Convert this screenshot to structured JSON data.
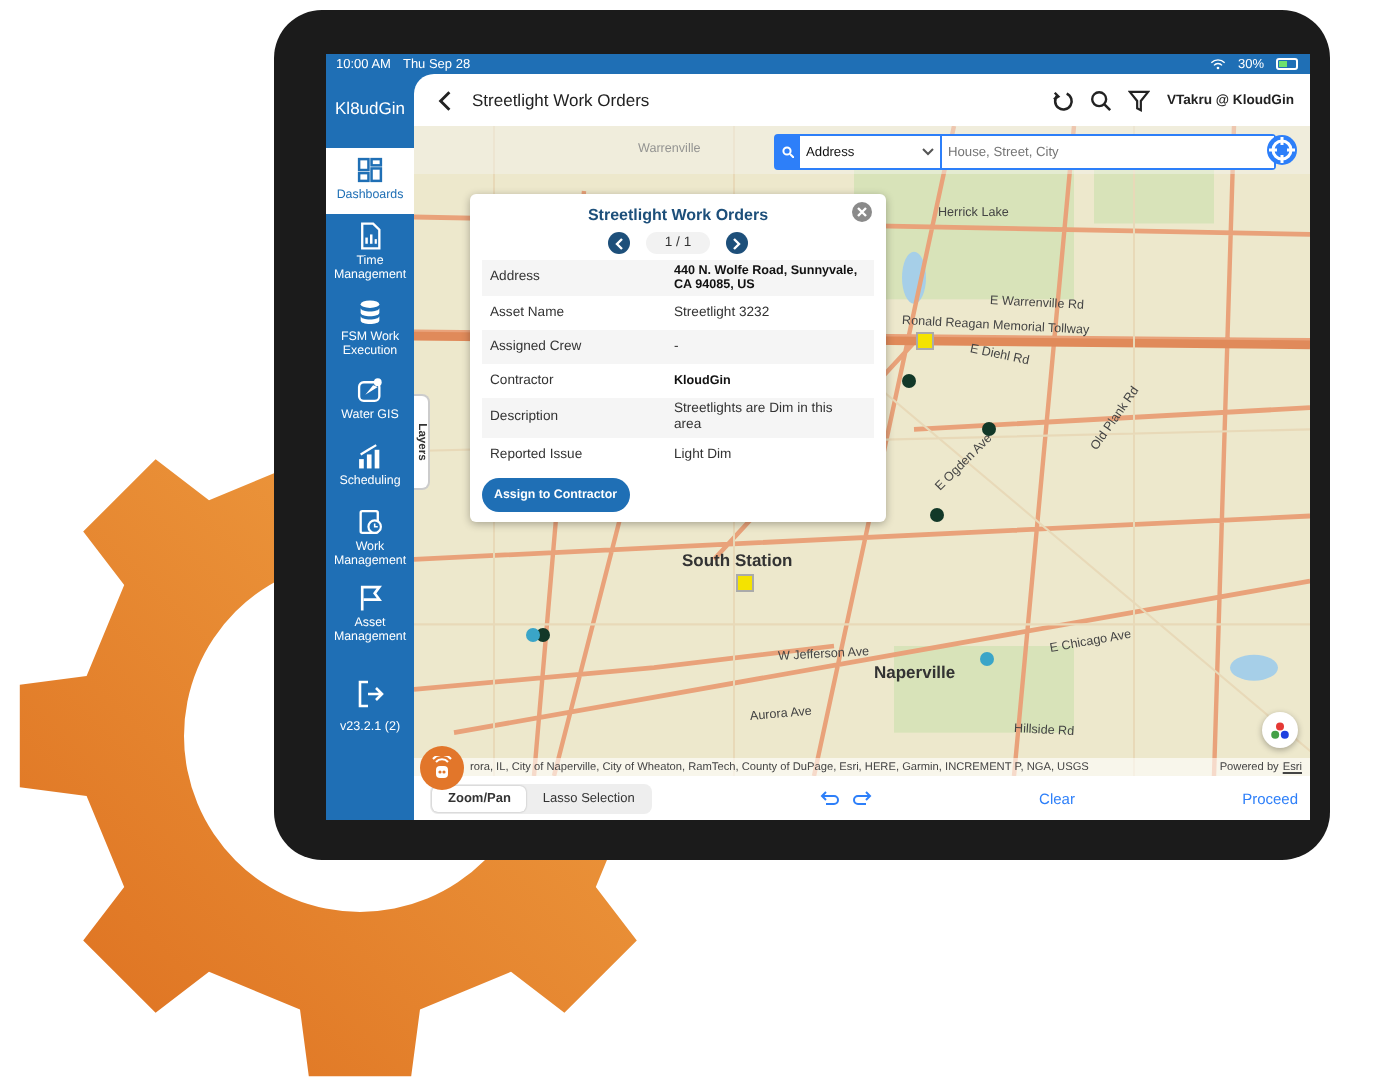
{
  "status_bar": {
    "time": "10:00 AM",
    "date": "Thu Sep 28",
    "battery": "30%"
  },
  "sidebar": {
    "logo": "Kl8udGin",
    "version": "v23.2.1 (2)",
    "items": [
      {
        "label": "Dashboards",
        "selected": true
      },
      {
        "label": "Time Management",
        "selected": false
      },
      {
        "label": "FSM Work Execution",
        "selected": false
      },
      {
        "label": "Water GIS",
        "selected": false
      },
      {
        "label": "Scheduling",
        "selected": false
      },
      {
        "label": "Work Management",
        "selected": false
      },
      {
        "label": "Asset Management",
        "selected": false
      }
    ]
  },
  "header": {
    "title": "Streetlight Work Orders",
    "user": "VTakru @ KloudGin"
  },
  "search": {
    "mode": "Address",
    "placeholder": "House, Street, City"
  },
  "map": {
    "labels": [
      "Warrenville",
      "Herrick Lake",
      "E Warrenville Rd",
      "Ronald Reagan Memorial Tollway",
      "E Diehl Rd",
      "Old Plank Rd",
      "E Ogden Ave",
      "South Station",
      "E Chicago Ave",
      "W Jefferson Ave",
      "Naperville",
      "Aurora Ave",
      "Hillside Rd"
    ],
    "attribution": "rora, IL, City of Naperville, City of Wheaton, RamTech, County of DuPage, Esri, HERE, Garmin, INCREMENT P, NGA, USGS",
    "powered_by": "Powered by",
    "powered_link": "Esri",
    "layers": "Layers"
  },
  "popup": {
    "title": "Streetlight Work Orders",
    "pager": "1 / 1",
    "button": "Assign to Contractor",
    "rows": [
      {
        "label": "Address",
        "value": "440 N. Wolfe Road, Sunnyvale, CA 94085, US",
        "strong": true
      },
      {
        "label": "Asset Name",
        "value": "Streetlight 3232",
        "strong": false
      },
      {
        "label": "Assigned Crew",
        "value": "-",
        "strong": false
      },
      {
        "label": "Contractor",
        "value": "KloudGin",
        "strong": true
      },
      {
        "label": "Description",
        "value": "Streetlights are Dim in this area",
        "strong": false
      },
      {
        "label": "Reported Issue",
        "value": "Light Dim",
        "strong": false
      }
    ]
  },
  "bottom_bar": {
    "modes": [
      {
        "label": "Zoom/Pan",
        "selected": true
      },
      {
        "label": "Lasso Selection",
        "selected": false
      }
    ],
    "actions": [
      "Clear",
      "Proceed"
    ]
  }
}
